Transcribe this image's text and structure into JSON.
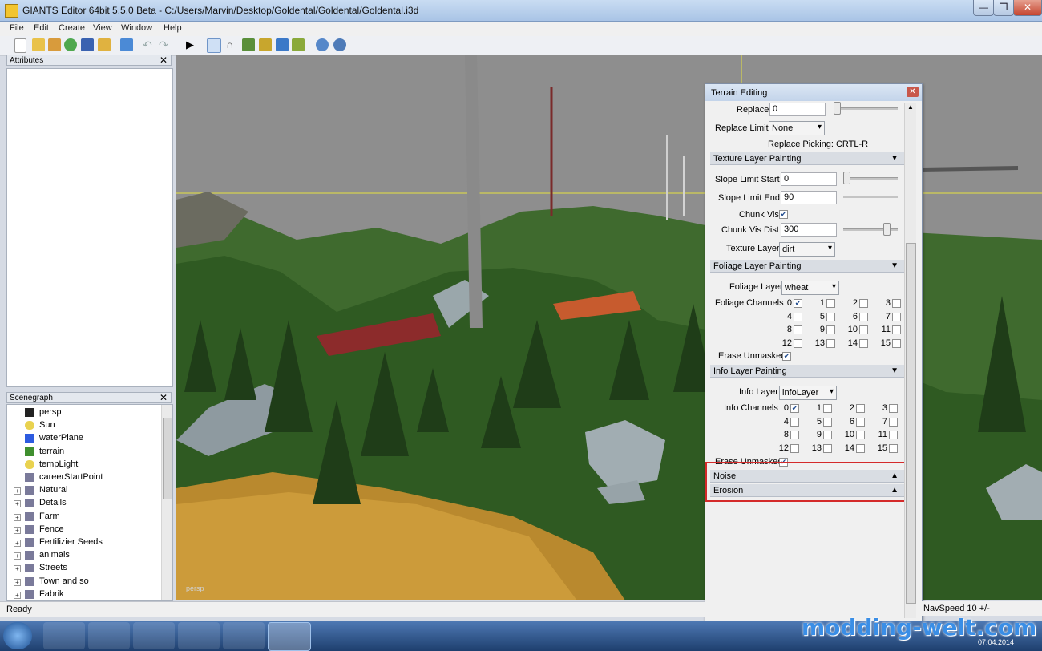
{
  "window": {
    "title": "GIANTS Editor 64bit 5.5.0 Beta - C:/Users/Marvin/Desktop/Goldental/Goldental/Goldental.i3d"
  },
  "menu": [
    "File",
    "Edit",
    "Create",
    "View",
    "Window",
    "Help"
  ],
  "toolbar": {
    "icons": [
      "new-icon",
      "open-icon",
      "edit-icon",
      "refresh-icon",
      "save-icon",
      "import-icon",
      "export-icon",
      "undo-icon",
      "redo-icon",
      "play-icon",
      "select-icon",
      "magnet-icon",
      "terrain-sculpt-icon",
      "paint-icon",
      "foliage-icon",
      "tree-icon",
      "settings-icon",
      "settings2-icon"
    ]
  },
  "attributes_panel": {
    "title": "Attributes"
  },
  "scenegraph_panel": {
    "title": "Scenegraph",
    "items": [
      {
        "label": "persp",
        "icon": "camera-icon",
        "expandable": false
      },
      {
        "label": "Sun",
        "icon": "light-icon",
        "expandable": false
      },
      {
        "label": "waterPlane",
        "icon": "cube-icon",
        "expandable": false
      },
      {
        "label": "terrain",
        "icon": "terrain-icon",
        "expandable": false
      },
      {
        "label": "tempLight",
        "icon": "light-icon",
        "expandable": false
      },
      {
        "label": "careerStartPoint",
        "icon": "transform-icon",
        "expandable": false
      },
      {
        "label": "Natural",
        "icon": "transform-icon",
        "expandable": true
      },
      {
        "label": "Details",
        "icon": "transform-icon",
        "expandable": true
      },
      {
        "label": "Farm",
        "icon": "transform-icon",
        "expandable": true
      },
      {
        "label": "Fence",
        "icon": "transform-icon",
        "expandable": true
      },
      {
        "label": "Fertilizier   Seeds",
        "icon": "transform-icon",
        "expandable": true
      },
      {
        "label": "animals",
        "icon": "transform-icon",
        "expandable": true
      },
      {
        "label": "Streets",
        "icon": "transform-icon",
        "expandable": true
      },
      {
        "label": "Town and so",
        "icon": "transform-icon",
        "expandable": true
      },
      {
        "label": "Fabrik",
        "icon": "transform-icon",
        "expandable": true
      }
    ]
  },
  "viewport": {
    "camera_label": "persp"
  },
  "terrain_editing": {
    "title": "Terrain Editing",
    "replace_label": "Replace",
    "replace_value": "0",
    "replace_limit_label": "Replace Limit",
    "replace_limit_value": "None",
    "replace_picking": "Replace Picking: CRTL-R",
    "texture_section": "Texture Layer Painting",
    "slope_start_label": "Slope Limit Start",
    "slope_start_value": "0",
    "slope_end_label": "Slope Limit End",
    "slope_end_value": "90",
    "chunk_vis_label": "Chunk Vis",
    "chunk_vis_dist_label": "Chunk Vis Dist",
    "chunk_vis_dist_value": "300",
    "texture_layer_label": "Texture Layer",
    "texture_layer_value": "dirt",
    "foliage_section": "Foliage Layer Painting",
    "foliage_layer_label": "Foliage Layer",
    "foliage_layer_value": "wheat",
    "foliage_channels_label": "Foliage Channels",
    "foliage_channels_checked": [
      0
    ],
    "erase_unmasked_label": "Erase Unmasked",
    "info_section": "Info Layer Painting",
    "info_layer_label": "Info Layer",
    "info_layer_value": "infoLayer",
    "info_channels_label": "Info Channels",
    "info_channels_checked": [
      0
    ],
    "erase_unmasked2_label": "Erase Unmasked",
    "noise_section": "Noise",
    "erosion_section": "Erosion",
    "channel_numbers": [
      "0",
      "1",
      "2",
      "3",
      "4",
      "5",
      "6",
      "7",
      "8",
      "9",
      "10",
      "11",
      "12",
      "13",
      "14",
      "15"
    ]
  },
  "status": {
    "text": "Ready",
    "navspeed": "NavSpeed 10 +/-"
  },
  "watermark": "modding-welt.com",
  "taskbar": {
    "date": "07.04.2014",
    "apps": [
      "windows-start-icon",
      "media-player-icon",
      "explorer-icon",
      "chrome-icon",
      "steam-icon",
      "editor-icon",
      "giants-editor-icon"
    ]
  }
}
